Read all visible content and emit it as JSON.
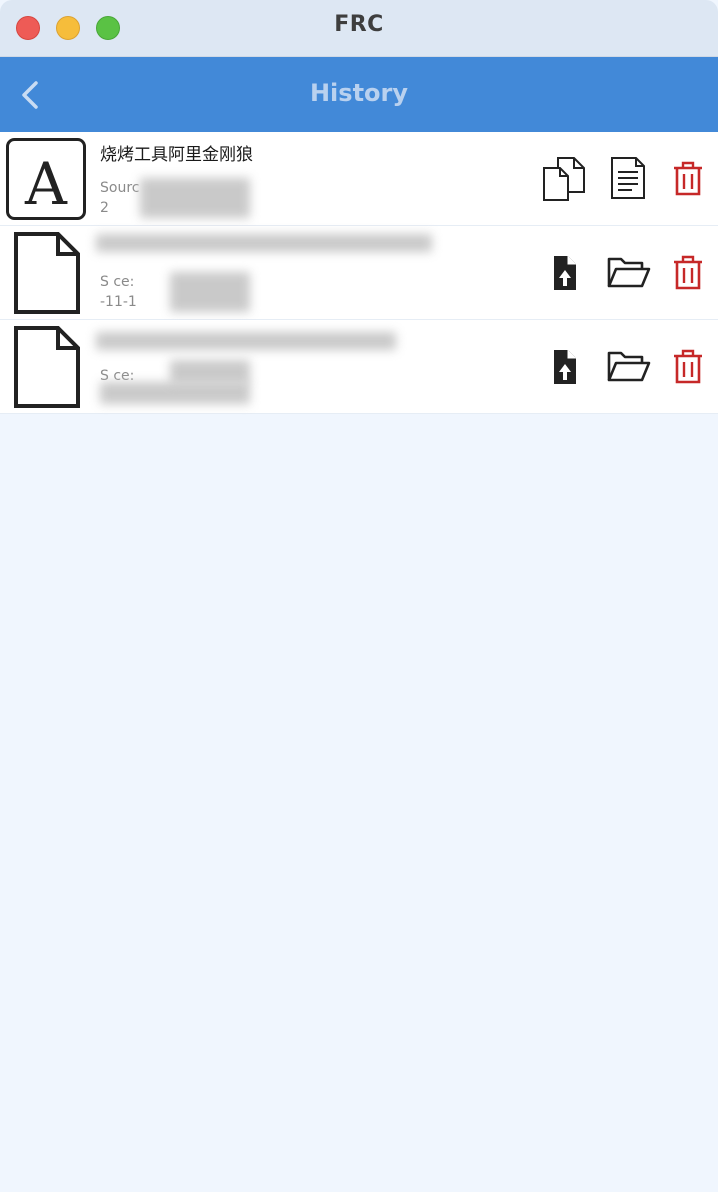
{
  "window": {
    "title": "FRC"
  },
  "navbar": {
    "title": "History"
  },
  "history": {
    "items": [
      {
        "type": "text",
        "title": "烧烤工具阿里金刚狼",
        "source": "Sourc",
        "time": "2",
        "actions": [
          "copy-icon",
          "document-icon",
          "trash-icon"
        ]
      },
      {
        "type": "file",
        "title": "",
        "source": "S ce:",
        "time": "-11-1",
        "actions": [
          "file-upload-icon",
          "folder-open-icon",
          "trash-icon"
        ]
      },
      {
        "type": "file",
        "title": "",
        "source": "S ce:",
        "time": "",
        "actions": [
          "file-upload-icon",
          "folder-open-icon",
          "trash-icon"
        ]
      }
    ]
  },
  "colors": {
    "titlebar": "#dde7f3",
    "navbar": "#4289d8",
    "nav_title": "#b9d1ef",
    "delete_red": "#c62828",
    "background": "#f0f6fe"
  }
}
